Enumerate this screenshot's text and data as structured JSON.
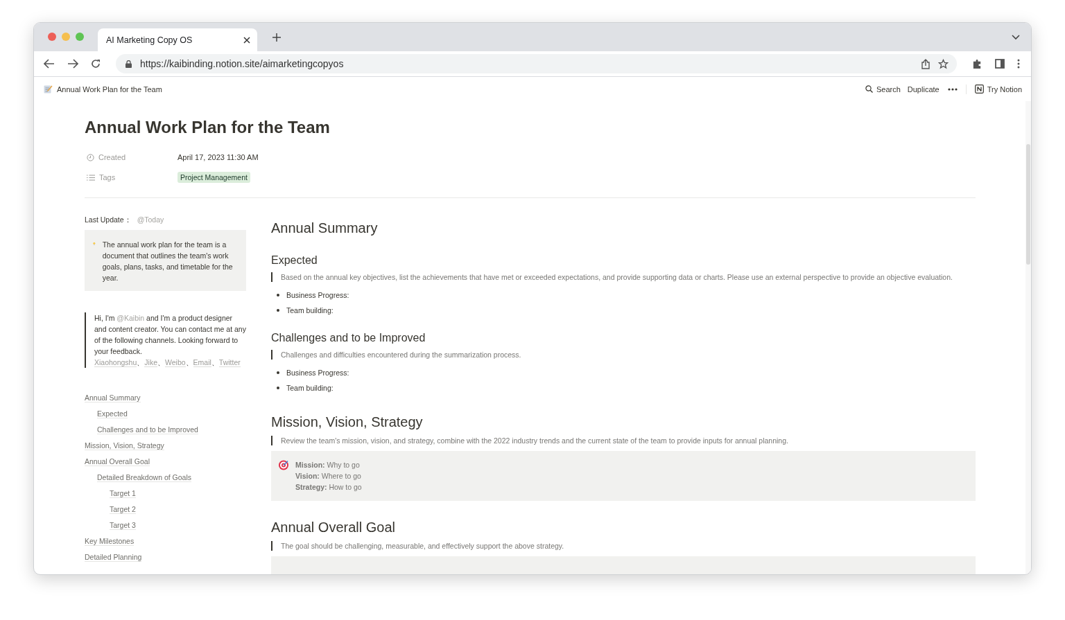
{
  "browser": {
    "tab_title": "AI Marketing Copy OS",
    "url": "https://kaibinding.notion.site/aimarketingcopyos"
  },
  "topbar": {
    "breadcrumb": "Annual Work Plan for the Team",
    "search": "Search",
    "duplicate": "Duplicate",
    "try_notion": "Try Notion"
  },
  "page": {
    "title": "Annual Work Plan for the Team",
    "properties": [
      {
        "kind": "date",
        "label": "Created",
        "value": "April 17, 2023 11:30 AM"
      },
      {
        "kind": "tag",
        "label": "Tags",
        "value": "Project Management",
        "color": "#dbeddb"
      }
    ]
  },
  "sidebar": {
    "last_update_label": "Last Update：",
    "last_update_value": "@Today",
    "callout": "The annual work plan for the team is a document that outlines the team's work goals, plans, tasks, and timetable for the year.",
    "intro": {
      "before": "Hi, I'm ",
      "mention": "@Kaibin",
      "after": " and I'm a product designer and content creator. You can contact me at any of the following channels. Looking forward to your feedback.",
      "separator": "、",
      "links": [
        "Xiaohongshu",
        "Jike",
        "Weibo",
        "Email",
        "Twitter"
      ]
    },
    "toc": [
      {
        "label": "Annual Summary",
        "children": [
          {
            "label": "Expected"
          },
          {
            "label": "Challenges and to be Improved"
          }
        ]
      },
      {
        "label": "Mission, Vision, Strategy"
      },
      {
        "label": "Annual Overall Goal",
        "children": [
          {
            "label": "Detailed Breakdown of Goals",
            "children": [
              {
                "label": "Target 1"
              },
              {
                "label": "Target 2"
              },
              {
                "label": "Target 3"
              }
            ]
          }
        ]
      },
      {
        "label": "Key Milestones"
      },
      {
        "label": "Detailed Planning"
      }
    ]
  },
  "blocks": [
    {
      "kind": "h1",
      "text": "Annual Summary"
    },
    {
      "kind": "h2",
      "text": "Expected"
    },
    {
      "kind": "quote",
      "text": "Based on the annual key objectives, list the achievements that have met or exceeded expectations, and provide supporting data or charts. Please use an external perspective to provide an objective evaluation."
    },
    {
      "kind": "bullet",
      "text": "Business Progress:"
    },
    {
      "kind": "bullet",
      "text": "Team building:"
    },
    {
      "kind": "h2",
      "text": "Challenges and to be Improved"
    },
    {
      "kind": "quote",
      "text": "Challenges and difficulties encountered during the summarization process."
    },
    {
      "kind": "bullet",
      "text": "Business Progress:"
    },
    {
      "kind": "bullet",
      "text": "Team building:"
    },
    {
      "kind": "h1",
      "text": "Mission, Vision, Strategy"
    },
    {
      "kind": "quote",
      "text": "Review the team's mission, vision, and strategy, combine with the 2022 industry trends and the current state of the team to provide inputs for annual planning."
    },
    {
      "kind": "callout",
      "lines": [
        "**Mission:** Why to go",
        "**Vision:** Where to go",
        "**Strategy:** How to go"
      ]
    },
    {
      "kind": "h1",
      "text": "Annual Overall Goal"
    },
    {
      "kind": "quote",
      "text": "The goal should be challenging, measurable, and effectively support the above strategy."
    },
    {
      "kind": "empty_callout"
    }
  ]
}
